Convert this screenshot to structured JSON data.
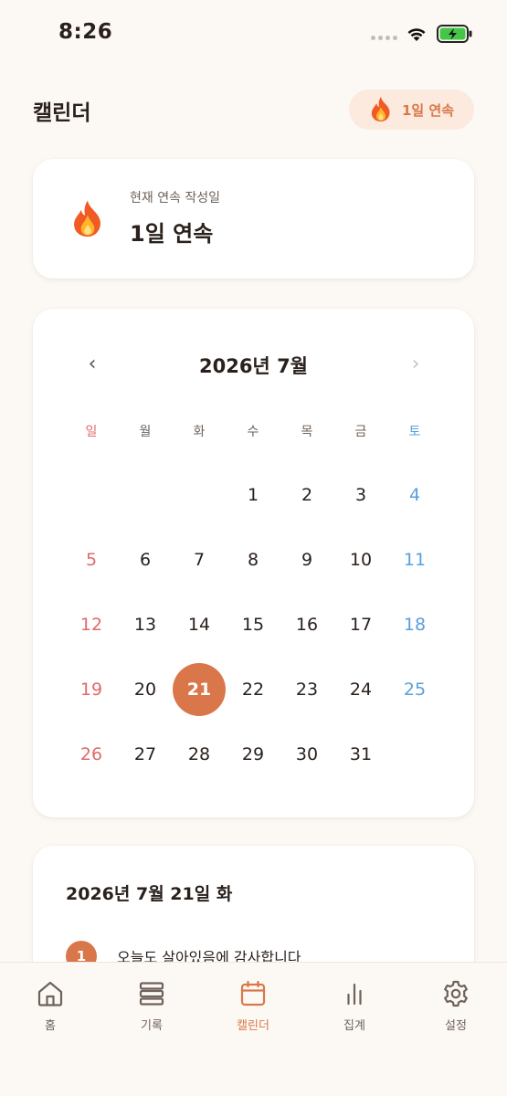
{
  "status_bar": {
    "time": "8:26"
  },
  "header": {
    "title": "캘린더",
    "streak_badge": "1일 연속"
  },
  "streak_card": {
    "label": "현재 연속 작성일",
    "value": "1일 연속"
  },
  "calendar": {
    "prev_label": "‹",
    "next_label": "›",
    "month_title": "2026년 7월",
    "weekdays": [
      "일",
      "월",
      "화",
      "수",
      "목",
      "금",
      "토"
    ],
    "weeks": [
      [
        "",
        "",
        "",
        "1",
        "2",
        "3",
        "4"
      ],
      [
        "5",
        "6",
        "7",
        "8",
        "9",
        "10",
        "11"
      ],
      [
        "12",
        "13",
        "14",
        "15",
        "16",
        "17",
        "18"
      ],
      [
        "19",
        "20",
        "21",
        "22",
        "23",
        "24",
        "25"
      ],
      [
        "26",
        "27",
        "28",
        "29",
        "30",
        "31",
        ""
      ]
    ],
    "selected_day": "21"
  },
  "detail": {
    "date_title": "2026년 7월 21일 화",
    "entries": [
      {
        "number": "1",
        "text": "오늘도 살아있음에 감사합니다"
      }
    ]
  },
  "tabs": [
    {
      "label": "홈",
      "icon": "home-icon",
      "active": false
    },
    {
      "label": "기록",
      "icon": "list-icon",
      "active": false
    },
    {
      "label": "캘린더",
      "icon": "calendar-icon",
      "active": true
    },
    {
      "label": "집계",
      "icon": "bar-chart-icon",
      "active": false
    },
    {
      "label": "설정",
      "icon": "gear-icon",
      "active": false
    }
  ],
  "colors": {
    "accent": "#d9774a",
    "background": "#fcf9f5",
    "sunday": "#e06a6a",
    "saturday": "#5a9fdc",
    "pill_background": "#fbeadd"
  }
}
